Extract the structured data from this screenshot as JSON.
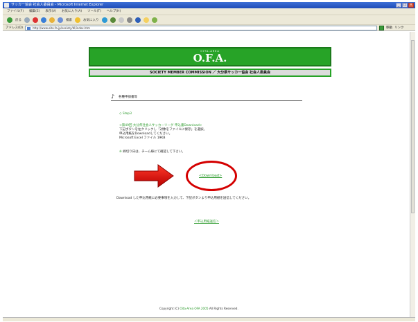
{
  "window": {
    "title": "サッカー協会 社会人委員会 - Microsoft Internet Explorer",
    "controls": [
      "_",
      "□",
      "×"
    ]
  },
  "menubar": [
    "ファイル(F)",
    "編集(E)",
    "表示(V)",
    "お気に入り(A)",
    "ツール(T)",
    "ヘルプ(H)"
  ],
  "toolbar": {
    "back": "戻る",
    "search": "検索",
    "favorites": "お気に入り"
  },
  "addressbar": {
    "label": "アドレス(D)",
    "url": "http://www.oita-fa.jp/society/dl/index.htm",
    "go": "移動",
    "links": "リンク"
  },
  "banner": {
    "small": "OITA-AREA",
    "big": "O.F.A."
  },
  "subbanner": "SOCIETY MEMBER COMMISSION ／ 大分県サッカー協会 社会人委員会",
  "section_title": "各種申請書等",
  "step": "Step3",
  "desc_lines": [
    "<第49回 大分県社会人サッカーリーグ 申込書Download>",
    "下記ボタンを左クリックし「対象をファイルに保存」を選択。",
    "申込用紙をDownloadしてください。",
    "Microsoft Excel ファイル 19KB"
  ],
  "note": "締切り日は、チーム毎にて確認して下さい。",
  "download_link": "<Download>",
  "instruction": "Download した申込用紙に必要事項を入力して、下記ボタンより申込用紙を送信してください。",
  "back_link": "＜申込用紙送信＞",
  "copyright": {
    "prefix": "Copyright (C)",
    "org": "Oita-Area OFA 2005",
    "suffix": "All Rights Reserved."
  },
  "colors": {
    "brand_green": "#27a327",
    "link_green": "#2a9a2a",
    "annotation_red": "#d40000"
  }
}
